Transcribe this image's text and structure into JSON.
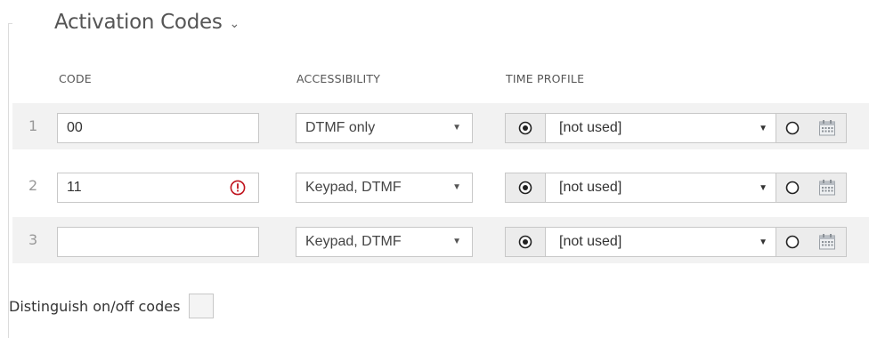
{
  "section": {
    "title": "Activation Codes",
    "chevron_icon": "chevron-down-icon"
  },
  "columns": {
    "code": "CODE",
    "accessibility": "ACCESSIBILITY",
    "time_profile": "TIME PROFILE"
  },
  "rows": [
    {
      "index": "1",
      "code": "00",
      "code_error": false,
      "accessibility": "DTMF only",
      "time_profile": "[not used]",
      "time_profile_mode": "select"
    },
    {
      "index": "2",
      "code": "11",
      "code_error": true,
      "accessibility": "Keypad, DTMF",
      "time_profile": "[not used]",
      "time_profile_mode": "select"
    },
    {
      "index": "3",
      "code": "",
      "code_error": false,
      "accessibility": "Keypad, DTMF",
      "time_profile": "[not used]",
      "time_profile_mode": "select"
    }
  ],
  "distinguish": {
    "label": "Distinguish on/off codes",
    "checked": false
  },
  "colors": {
    "row_shade": "#f2f2f2",
    "border": "#c8c8c8",
    "error": "#c0141e",
    "calendar_icon": "#9aa0a6"
  }
}
